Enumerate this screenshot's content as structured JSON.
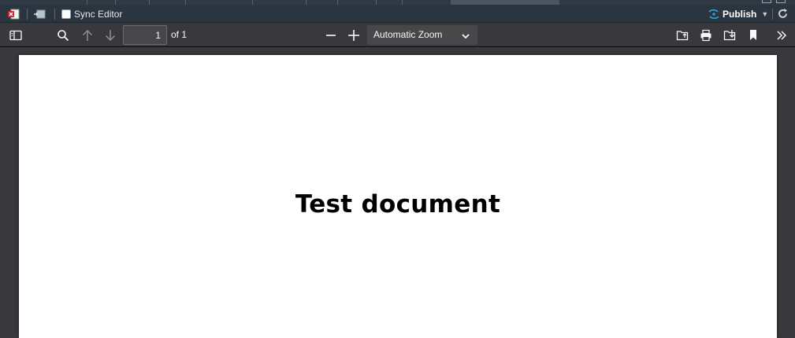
{
  "editor_toolbar": {
    "sync_editor_label": "Sync Editor",
    "sync_editor_checked": false,
    "publish_label": "Publish"
  },
  "pdf_toolbar": {
    "page_number": "1",
    "page_count_label": "of 1",
    "zoom_value": "Automatic Zoom"
  },
  "document": {
    "title": "Test document"
  },
  "colors": {
    "editor_toolbar_bg": "#2b3540",
    "pdf_toolbar_bg": "#38383d",
    "page_bg": "#ffffff",
    "publish_icon": "#2f9bd6"
  },
  "icons": {
    "close_document": "pdf-close-icon",
    "preview": "preview-icon",
    "sidebar_toggle": "sidebar-toggle-icon",
    "search": "search-icon",
    "previous_page": "arrow-up-icon",
    "next_page": "arrow-down-icon",
    "zoom_out": "minus-icon",
    "zoom_in": "plus-icon",
    "open_file": "open-file-icon",
    "print": "print-icon",
    "download": "download-icon",
    "bookmark": "bookmark-icon",
    "tools": "double-chevron-right-icon",
    "refresh": "refresh-icon"
  }
}
